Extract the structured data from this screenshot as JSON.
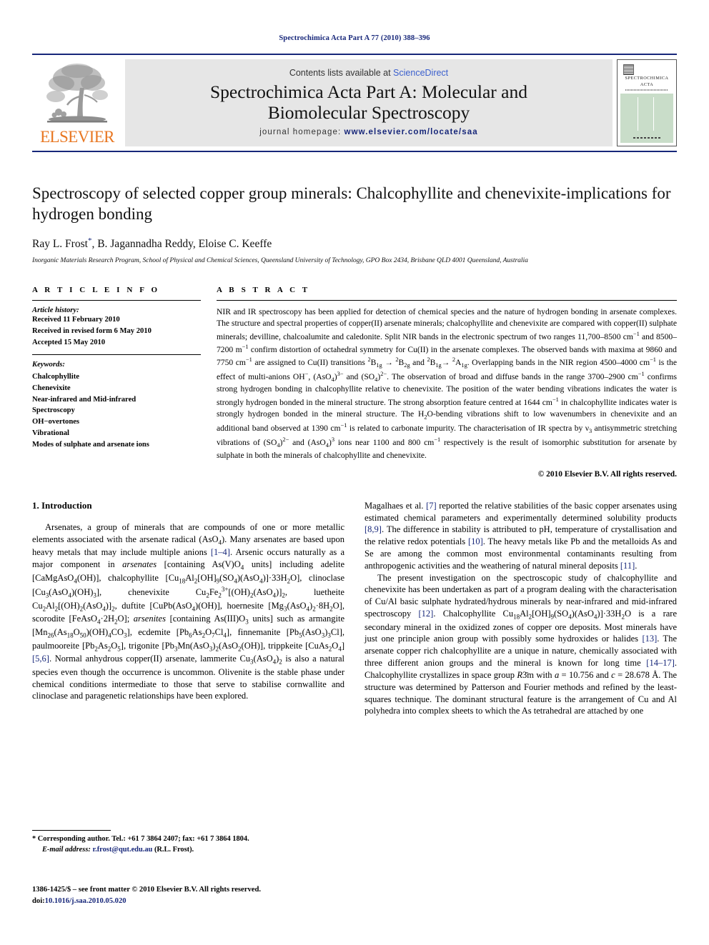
{
  "running_head": "Spectrochimica Acta Part A 77 (2010) 388–396",
  "masthead": {
    "publisher_logo_label": "ELSEVIER",
    "contents_prefix": "Contents lists available at ",
    "contents_link": "ScienceDirect",
    "journal_title_line1": "Spectrochimica Acta Part A: Molecular and",
    "journal_title_line2": "Biomolecular Spectroscopy",
    "homepage_prefix": "journal homepage: ",
    "homepage_url": "www.elsevier.com/locate/saa",
    "cover_title_line1": "SPECTROCHIMICA",
    "cover_title_line2": "ACTA"
  },
  "article": {
    "title": "Spectroscopy of selected copper group minerals: Chalcophyllite and chenevixite-implications for hydrogen bonding",
    "authors": "Ray L. Frost",
    "author_marker": "*",
    "authors_rest": ", B. Jagannadha Reddy, Eloise C. Keeffe",
    "affiliation": "Inorganic Materials Research Program, School of Physical and Chemical Sciences, Queensland University of Technology, GPO Box 2434, Brisbane QLD 4001 Queensland, Australia"
  },
  "article_info": {
    "heading": "A R T I C L E   I N F O",
    "history_label": "Article history:",
    "history": [
      "Received 11 February 2010",
      "Received in revised form 6 May 2010",
      "Accepted 15 May 2010"
    ],
    "keywords_label": "Keywords:",
    "keywords": [
      "Chalcophyllite",
      "Chenevixite",
      "Near-infrared and Mid-infrared",
      "Spectroscopy",
      "OH−overtones",
      "Vibrational",
      "Modes of sulphate and arsenate ions"
    ]
  },
  "abstract": {
    "heading": "A B S T R A C T",
    "paragraphs": [
      "NIR and IR spectroscopy has been applied for detection of chemical species and the nature of hydrogen bonding in arsenate complexes. The structure and spectral properties of copper(II) arsenate minerals; chalcophyllite and chenevixite are compared with copper(II) sulphate minerals; devilline, chalcoalumite and caledonite. Split NIR bands in the electronic spectrum of two ranges 11,700–8500 cm−1 and 8500–7200 m−1 confirm distortion of octahedral symmetry for Cu(II) in the arsenate complexes. The observed bands with maxima at 9860 and 7750 cm−1 are assigned to Cu(II) transitions 2B1g → 2B2g and 2B1g → 2A1g. Overlapping bands in the NIR region 4500–4000 cm−1 is the effect of multi-anions OH−, (AsO4)3− and (SO4)2−. The observation of broad and diffuse bands in the range 3700–2900 cm−1 confirms strong hydrogen bonding in chalcophyllite relative to chenevixite. The position of the water bending vibrations indicates the water is strongly hydrogen bonded in the mineral structure. The strong absorption feature centred at 1644 cm−1 in chalcophyllite indicates water is strongly hydrogen bonded in the mineral structure. The H2O-bending vibrations shift to low wavenumbers in chenevixite and an additional band observed at 1390 cm−1 is related to carbonate impurity. The characterisation of IR spectra by ν3 antisymmetric stretching vibrations of (SO4)2− and (AsO4)3 ions near 1100 and 800 cm−1 respectively is the result of isomorphic substitution for arsenate by sulphate in both the minerals of chalcophyllite and chenevixite."
    ],
    "copyright": "© 2010 Elsevier B.V. All rights reserved."
  },
  "section": {
    "number_title": "1. Introduction"
  },
  "footnote": {
    "corresponding": "* Corresponding author. Tel.: +61 7 3864 2407; fax: +61 7 3864 1804.",
    "email_label": "E-mail address:",
    "email": "r.frost@qut.edu.au",
    "email_owner": "(R.L. Frost).",
    "issn_line": "1386-1425/$ – see front matter © 2010 Elsevier B.V. All rights reserved.",
    "doi_label": "doi:",
    "doi": "10.1016/j.saa.2010.05.020"
  },
  "colors": {
    "link": "#17277a",
    "sciencedirect": "#3a5fcd",
    "elsevier_orange": "#e87722",
    "banner_bg": "#e6e6e6",
    "cover_green": "#c9ddc9"
  }
}
